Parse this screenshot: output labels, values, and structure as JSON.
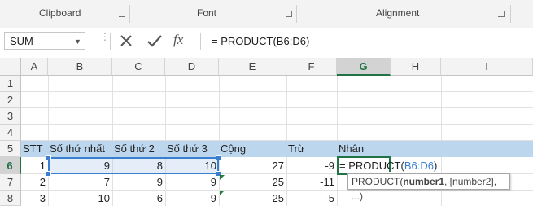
{
  "ribbon": {
    "groups": [
      {
        "label": "Clipboard"
      },
      {
        "label": "Font"
      },
      {
        "label": "Alignment"
      }
    ]
  },
  "formula_bar": {
    "name_box": "SUM",
    "cancel_icon": "cancel-x-icon",
    "enter_icon": "checkmark-icon",
    "fx_label": "fx",
    "formula": "= PRODUCT(B6:D6)"
  },
  "columns": [
    "A",
    "B",
    "C",
    "D",
    "E",
    "F",
    "G",
    "H",
    "I"
  ],
  "selected_column": "G",
  "rows": [
    "1",
    "2",
    "3",
    "4",
    "5",
    "6",
    "7",
    "8"
  ],
  "selected_row": "6",
  "headers_row5": {
    "A": "STT",
    "B": "Số thứ nhất",
    "C": "Số thứ 2",
    "D": "Số thứ 3",
    "E": "Cộng",
    "F": "Trừ",
    "G": "Nhân"
  },
  "data_rows": [
    {
      "A": "1",
      "B": "9",
      "C": "8",
      "D": "10",
      "E": "27",
      "F": "-9"
    },
    {
      "A": "2",
      "B": "7",
      "C": "9",
      "D": "9",
      "E": "25",
      "F": "-11"
    },
    {
      "A": "3",
      "B": "10",
      "C": "6",
      "D": "9",
      "E": "25",
      "F": "-5"
    }
  ],
  "editing_cell": {
    "prefix": "= PRODUCT(",
    "ref": "B6:D6",
    "suffix": ")"
  },
  "tooltip": {
    "fn": "PRODUCT(",
    "arg1": "number1",
    "rest": ", [number2], ...)"
  },
  "colors": {
    "accent_green": "#217346",
    "ref_blue": "#3a7fcf",
    "row5_fill": "#bcd6ee"
  }
}
